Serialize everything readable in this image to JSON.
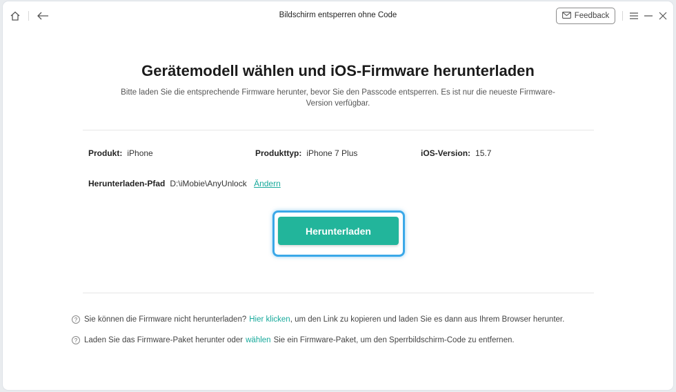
{
  "titlebar": {
    "title": "Bildschirm entsperren ohne Code",
    "feedback_label": "Feedback",
    "icons": [
      "home-icon",
      "back-arrow-icon",
      "mail-icon",
      "menu-icon",
      "minimize-icon",
      "close-icon"
    ]
  },
  "main": {
    "heading": "Gerätemodell wählen und iOS-Firmware herunterladen",
    "subtitle": "Bitte laden Sie die entsprechende Firmware herunter, bevor Sie den Passcode entsperren. Es ist nur die neueste Firmware-Version verfügbar."
  },
  "device": {
    "product_label": "Produkt:",
    "product_value": "iPhone",
    "type_label": "Produkttyp:",
    "type_value": "iPhone 7 Plus",
    "ios_label": "iOS-Version:",
    "ios_value": "15.7",
    "path_label": "Herunterladen-Pfad",
    "path_value": "D:\\iMobie\\AnyUnlock",
    "change_link": "Ändern"
  },
  "download_button": "Herunterladen",
  "notes": {
    "note1_before": "Sie können die Firmware nicht herunterladen?",
    "note1_link": "Hier klicken",
    "note1_after": ", um den Link zu kopieren und laden Sie es dann aus Ihrem Browser herunter.",
    "note2_before": "Laden Sie das Firmware-Paket herunter oder",
    "note2_link": "wählen",
    "note2_after": "Sie ein Firmware-Paket, um den Sperrbildschirm-Code zu entfernen."
  },
  "colors": {
    "accent": "#22b59b",
    "link": "#17a99b",
    "focus_ring": "#3aa8e8"
  }
}
